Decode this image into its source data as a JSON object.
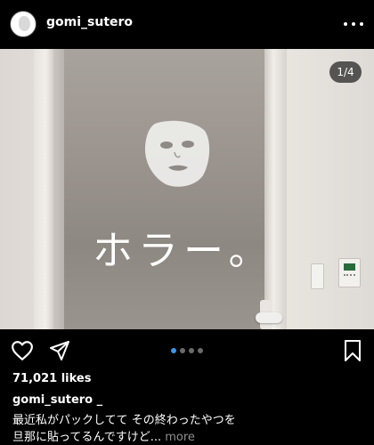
{
  "post": {
    "username": "gomi_sutero",
    "image_text": "ホラー。",
    "counter": "1/4",
    "likes": "71,021 likes",
    "caption_user": "gomi_sutero _",
    "caption_line1": "最近私がパックしてて その終わったやつを",
    "caption_line2": "旦那に貼ってるんですけど...",
    "more_label": "more",
    "carousel_dots": 4,
    "active_dot": 1
  },
  "colors": {
    "background": "#000000",
    "accent_dot": "#3897f0",
    "muted_text": "#8e8e8e"
  },
  "icons": {
    "header": "more-horizontal-icon",
    "like": "heart-outline-icon",
    "share": "paper-plane-icon",
    "save": "bookmark-outline-icon"
  }
}
